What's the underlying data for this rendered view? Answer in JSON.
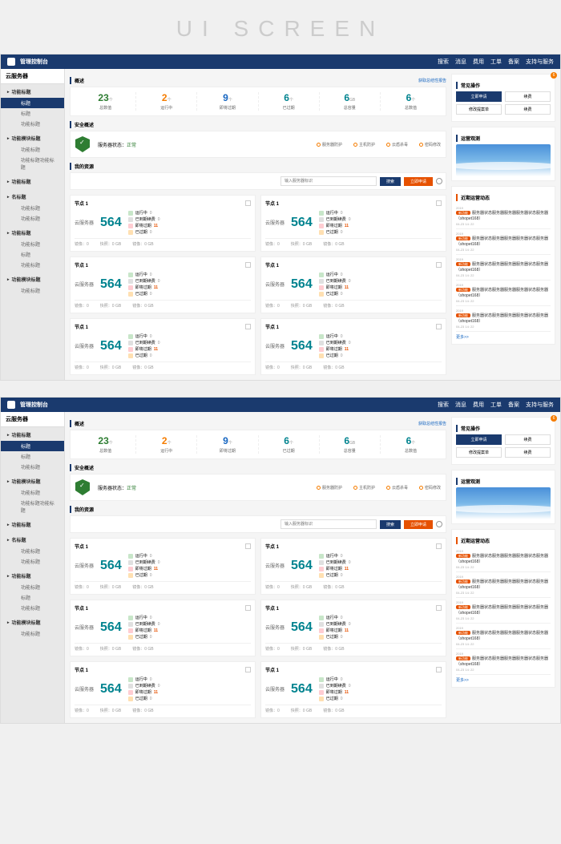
{
  "banner": "UI SCREEN",
  "header": {
    "title": "管理控制台",
    "search": "搜索",
    "nav": [
      "消息",
      "费用",
      "工单",
      "备案",
      "支持与服务"
    ]
  },
  "sidebar": {
    "header": "云服务器",
    "sections": [
      {
        "title": "功能标题",
        "items": [
          "标题",
          "标题",
          "功能标题"
        ]
      },
      {
        "title": "功能模块标题",
        "items": [
          "功能标题",
          "功能标题功能标题"
        ]
      },
      {
        "title": "功能标题",
        "items": []
      },
      {
        "title": "名标题",
        "items": [
          "功能标题",
          "功能标题"
        ]
      },
      {
        "title": "功能标题",
        "items": [
          "功能标题",
          "标题",
          "功能标题"
        ]
      },
      {
        "title": "功能模块标题",
        "items": [
          "功能标题"
        ]
      }
    ]
  },
  "overview": {
    "label": "概述",
    "report_link": "获取总结性报告",
    "stats": [
      {
        "num": "23",
        "sub": "个",
        "label": "总数值",
        "cls": "green"
      },
      {
        "num": "2",
        "sub": "个",
        "label": "运行中",
        "cls": "orange"
      },
      {
        "num": "9",
        "sub": "个",
        "label": "即将过期",
        "cls": "blue"
      },
      {
        "num": "6",
        "sub": "个",
        "label": "已过期",
        "cls": "teal"
      },
      {
        "num": "6",
        "sub": "GB",
        "label": "总容量",
        "cls": "teal"
      },
      {
        "num": "6",
        "sub": "个",
        "label": "总数值",
        "cls": "teal"
      }
    ]
  },
  "security": {
    "label": "安全概述",
    "status_text": "服务器状态：",
    "status_value": "正常",
    "items": [
      "服务器防护",
      "主机防护",
      "云盾杀毒",
      "密码修改"
    ]
  },
  "resources": {
    "label": "我的资源",
    "search_ph": "输入服务器标识",
    "btn_search": "搜索",
    "btn_apply": "立即申请",
    "cards": [
      {
        "title": "节点 1",
        "server_label": "云服务器",
        "count": "564",
        "metrics": [
          {
            "cls": "m-green",
            "name": "运行中",
            "val": "0"
          },
          {
            "cls": "m-gray",
            "name": "已到期续费",
            "val": "0"
          },
          {
            "cls": "m-red",
            "name": "即将过期",
            "val": "11",
            "hl": true
          },
          {
            "cls": "m-orange",
            "name": "已过期",
            "val": "0"
          }
        ],
        "footer": [
          {
            "k": "镜像",
            "v": "0"
          },
          {
            "k": "快照",
            "v": "0 GB"
          },
          {
            "k": "镜像",
            "v": "0 GB"
          }
        ]
      }
    ],
    "card_count": 6
  },
  "quick": {
    "label": "常见操作",
    "badge": "6",
    "rows": [
      [
        "立即申请",
        "续费"
      ],
      [
        "修改提案单",
        "续费"
      ]
    ]
  },
  "viz": {
    "label": "运营观测"
  },
  "news": {
    "label": "近期运营动态",
    "items": [
      {
        "date": "2019",
        "tag": "新功能",
        "title": "服务器状态服务器服务器服务器状态服务器（shopet168）",
        "time": "04-23 14: 22"
      },
      {
        "date": "2019",
        "tag": "新功能",
        "title": "服务器状态服务器服务器服务器状态服务器（shopet168）",
        "time": "04-23 14: 22"
      },
      {
        "date": "2019",
        "tag": "新功能",
        "title": "服务器状态服务器服务器服务器状态服务器（shopet168）",
        "time": "04-23 14: 22"
      },
      {
        "date": "2019",
        "tag": "新功能",
        "title": "服务器状态服务器服务器服务器状态服务器（shopet168）",
        "time": "04-23 14: 22"
      },
      {
        "date": "2019",
        "tag": "新功能",
        "title": "服务器状态服务器服务器服务器状态服务器（shopet168）",
        "time": "04-23 14: 22"
      }
    ],
    "more": "更多>>"
  }
}
